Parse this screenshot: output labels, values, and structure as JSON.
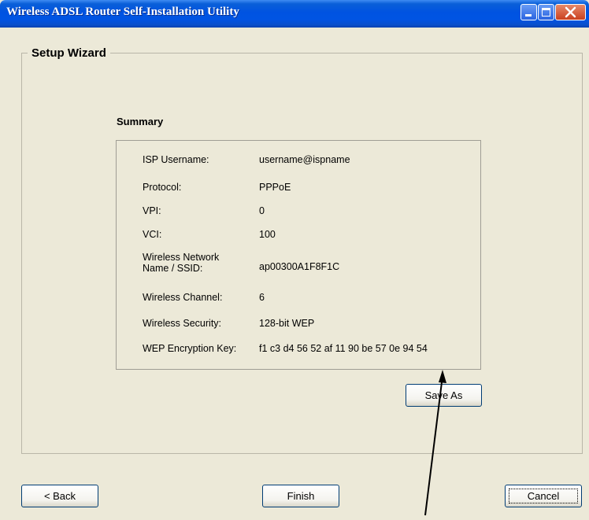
{
  "window": {
    "title": "Wireless ADSL Router Self-Installation Utility"
  },
  "wizard": {
    "group_title": "Setup Wizard",
    "summary_heading": "Summary"
  },
  "summary": [
    {
      "label": "ISP Username:",
      "value": "username@ispname"
    },
    {
      "label": "Protocol:",
      "value": "PPPoE"
    },
    {
      "label": "VPI:",
      "value": "0"
    },
    {
      "label": "VCI:",
      "value": "100"
    },
    {
      "label": "Wireless Network Name / SSID:",
      "value": "ap00300A1F8F1C"
    },
    {
      "label": "Wireless Channel:",
      "value": "6"
    },
    {
      "label": "Wireless Security:",
      "value": "128-bit WEP"
    },
    {
      "label": "WEP Encryption Key:",
      "value": "f1 c3 d4 56 52 af 11 90 be 57 0e 94 54"
    }
  ],
  "buttons": {
    "save_as": "Save As",
    "back": "< Back",
    "finish": "Finish",
    "cancel": "Cancel"
  },
  "colors": {
    "titlebar": "#0054e3",
    "window_bg": "#ece9d8"
  }
}
